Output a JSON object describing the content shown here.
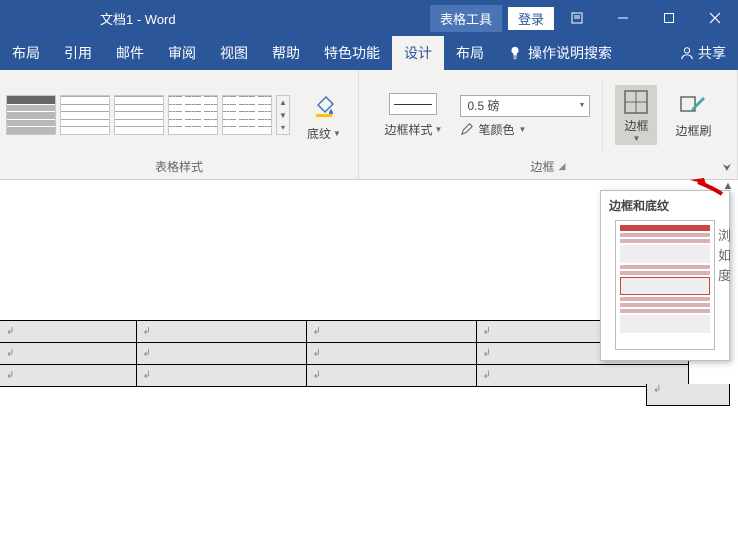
{
  "title": "文档1 - Word",
  "context_tab": "表格工具",
  "login": "登录",
  "tabs": [
    "布局",
    "引用",
    "邮件",
    "审阅",
    "视图",
    "帮助",
    "特色功能",
    "设计",
    "布局"
  ],
  "active_tab_index": 7,
  "search_placeholder": "操作说明搜索",
  "share": "共享",
  "ribbon": {
    "styles_group_label": "表格样式",
    "shading_label": "底纹",
    "border_style_label": "边框样式",
    "border_weight": "0.5 磅",
    "pen_color_label": "笔颜色",
    "borders_group_label": "边框",
    "border_button_label": "边框",
    "border_painter_label": "边框刷"
  },
  "tooltip": {
    "title": "边框和底纹"
  },
  "side_hint": [
    "浏",
    "如",
    "度"
  ],
  "cell_marker": "↲"
}
